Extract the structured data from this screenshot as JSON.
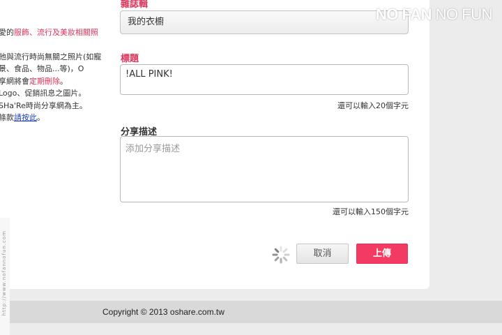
{
  "watermark": {
    "bold": "NO FAN",
    "light": " NO FUN"
  },
  "side_notes": {
    "line1_prefix": "愛的",
    "line1_red": "服飾、流行及美妝相關照",
    "line2": "他與流行時尚無關之照片(如寵",
    "line3": "景、食品、物品...等)，O",
    "line4_prefix": "享網將會",
    "line4_red": "定期刪除",
    "line4_suffix": "。",
    "line5": "Logo、促銷訊息之圖片。",
    "line6": "SHa'Re時尚分享網為主。",
    "line7_prefix": "條款",
    "line7_link": "請按此",
    "line7_suffix": "。"
  },
  "form": {
    "magazine_label": "雜誌輯",
    "magazine_value": "我的衣櫥",
    "title_label": "標題",
    "title_value": "!ALL PINK!",
    "title_hint": "還可以輸入20個字元",
    "desc_label": "分享描述",
    "desc_placeholder": "添加分享描述",
    "desc_hint": "還可以輸入150個字元"
  },
  "buttons": {
    "cancel": "取消",
    "upload": "上傳"
  },
  "footer": {
    "copyright": "Copyright © 2013 oshare.com.tw"
  },
  "left_edge_text": "http://www.nofannofun.com",
  "colors": {
    "accent": "#f23a63",
    "label_red": "#e0335a",
    "link": "#1a3fb8"
  }
}
